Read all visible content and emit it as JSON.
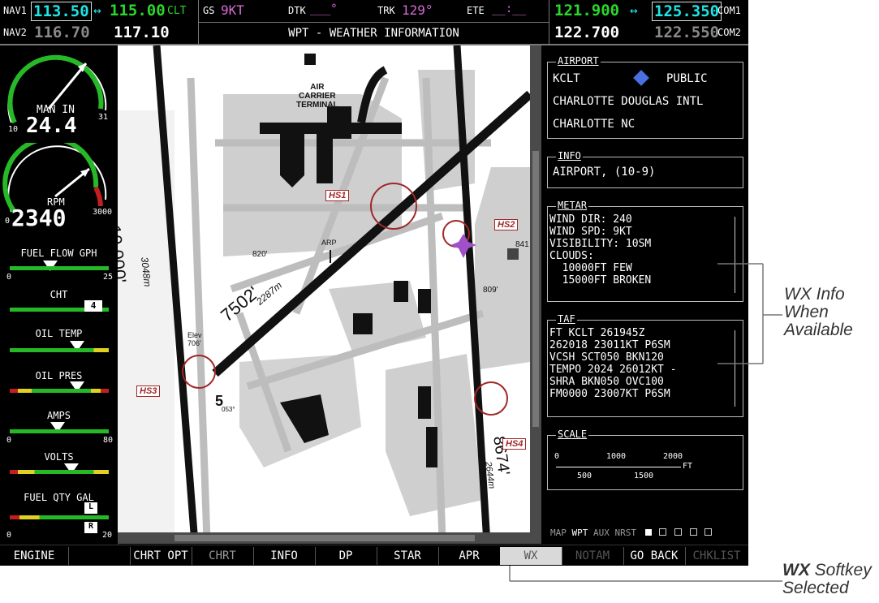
{
  "top_bar": {
    "nav1_label": "NAV1",
    "nav1_active": "113.50",
    "nav1_arrow": "↔",
    "nav1_standby": "115.00",
    "nav1_ident": "CLT",
    "nav2_label": "NAV2",
    "nav2_active": "116.70",
    "nav2_standby": "117.10",
    "gs_label": "GS",
    "gs_value": "9KT",
    "dtk_label": "DTK",
    "dtk_value": "___°",
    "trk_label": "TRK",
    "trk_value": "129°",
    "ete_label": "ETE",
    "ete_value": "__:__",
    "page_title": "WPT - WEATHER INFORMATION",
    "com1_active": "121.900",
    "com1_arrow": "↔",
    "com1_standby": "125.350",
    "com1_label": "COM1",
    "com2_active": "122.700",
    "com2_standby": "122.550",
    "com2_label": "COM2"
  },
  "engine": {
    "man_in_label": "MAN IN",
    "man_in_value": "24.4",
    "man_in_min": "10",
    "man_in_max": "31",
    "rpm_label": "RPM",
    "rpm_value": "2340",
    "rpm_min": "0",
    "rpm_max": "3000",
    "fuel_flow_label": "FUEL FLOW GPH",
    "fuel_flow_min": "0",
    "fuel_flow_max": "25",
    "cht_label": "CHT",
    "cht_cyl": "4",
    "oil_temp_label": "OIL TEMP",
    "oil_pres_label": "OIL PRES",
    "amps_label": "AMPS",
    "amps_min": "0",
    "amps_max": "80",
    "volts_label": "VOLTS",
    "fuel_qty_label": "FUEL QTY GAL",
    "fuel_qty_min": "0",
    "fuel_qty_max": "20",
    "fuel_qty_left": "L",
    "fuel_qty_right": "R"
  },
  "map": {
    "terminal_label": "AIR\nCARRIER\nTERMINAL",
    "runway_left_length": "10,000'",
    "runway_left_metric": "3048m",
    "runway_diag_length": "7502'",
    "runway_diag_metric": "2287m",
    "runway_right_length": "8674'",
    "runway_right_metric": "2644m",
    "hot_spots": [
      "HS1",
      "HS2",
      "HS3",
      "HS4"
    ],
    "elev_label": "Elev\n706'",
    "elev_820": "820'",
    "elev_809": "809'",
    "elev_841": "841",
    "arp_label": "ARP",
    "runway_5_label": "5",
    "runway_5_heading": "053°"
  },
  "panel": {
    "airport_header": "AIRPORT",
    "airport_id": "KCLT",
    "airport_type": "PUBLIC",
    "airport_name": "CHARLOTTE DOUGLAS INTL",
    "airport_city": "CHARLOTTE NC",
    "info_header": "INFO",
    "info_value": "AIRPORT, (10-9)",
    "metar_header": "METAR",
    "metar_lines": [
      "WIND DIR: 240",
      "WIND SPD: 9KT",
      "VISIBILITY: 10SM",
      "CLOUDS:",
      "  10000FT FEW",
      "  15000FT BROKEN"
    ],
    "taf_header": "TAF",
    "taf_lines": [
      "FT KCLT 261945Z",
      "262018 23011KT P6SM",
      "VCSH SCT050 BKN120",
      "TEMPO 2024 26012KT -",
      "SHRA BKN050 OVC100",
      "FM0000 23007KT P6SM"
    ],
    "scale_header": "SCALE",
    "scale_0": "0",
    "scale_1000": "1000",
    "scale_2000": "2000",
    "scale_500": "500",
    "scale_1500": "1500",
    "scale_unit": "FT",
    "page_group": [
      "MAP",
      "WPT",
      "AUX",
      "NRST"
    ],
    "page_group_active": "WPT"
  },
  "softkeys": [
    "ENGINE",
    "",
    "CHRT OPT",
    "CHRT",
    "INFO",
    "DP",
    "STAR",
    "APR",
    "WX",
    "NOTAM",
    "GO BACK",
    "CHKLIST"
  ],
  "callouts": {
    "wx_info_1": "WX Info",
    "wx_info_2": "When",
    "wx_info_3": "Available",
    "wx_softkey_bold": "WX",
    "wx_softkey_rest": " Softkey",
    "wx_softkey_2": "Selected"
  },
  "colors": {
    "green": "#2bd72b",
    "cyan": "#1ee4e4",
    "magenta": "#d86ad8",
    "hotspot": "#a02828"
  }
}
